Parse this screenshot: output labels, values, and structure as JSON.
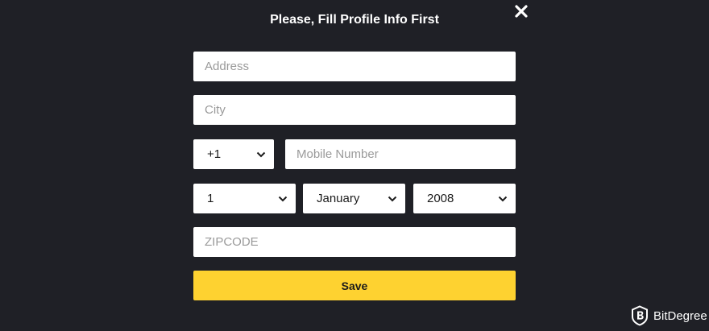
{
  "modal": {
    "title": "Please, Fill Profile Info First",
    "close_icon": "close-icon"
  },
  "form": {
    "address": {
      "placeholder": "Address",
      "value": ""
    },
    "city": {
      "placeholder": "City",
      "value": ""
    },
    "country_code": {
      "selected": "+1"
    },
    "mobile": {
      "placeholder": "Mobile Number",
      "value": ""
    },
    "birth_day": {
      "selected": "1"
    },
    "birth_month": {
      "selected": "January"
    },
    "birth_year": {
      "selected": "2008"
    },
    "zipcode": {
      "placeholder": "ZIPCODE",
      "value": ""
    },
    "save_label": "Save"
  },
  "watermark": {
    "label": "BitDegree",
    "icon": "bitdegree-logo-icon"
  },
  "colors": {
    "background": "#1f2026",
    "accent": "#fed230",
    "field": "#ffffff",
    "placeholder": "#9a9a9a"
  }
}
